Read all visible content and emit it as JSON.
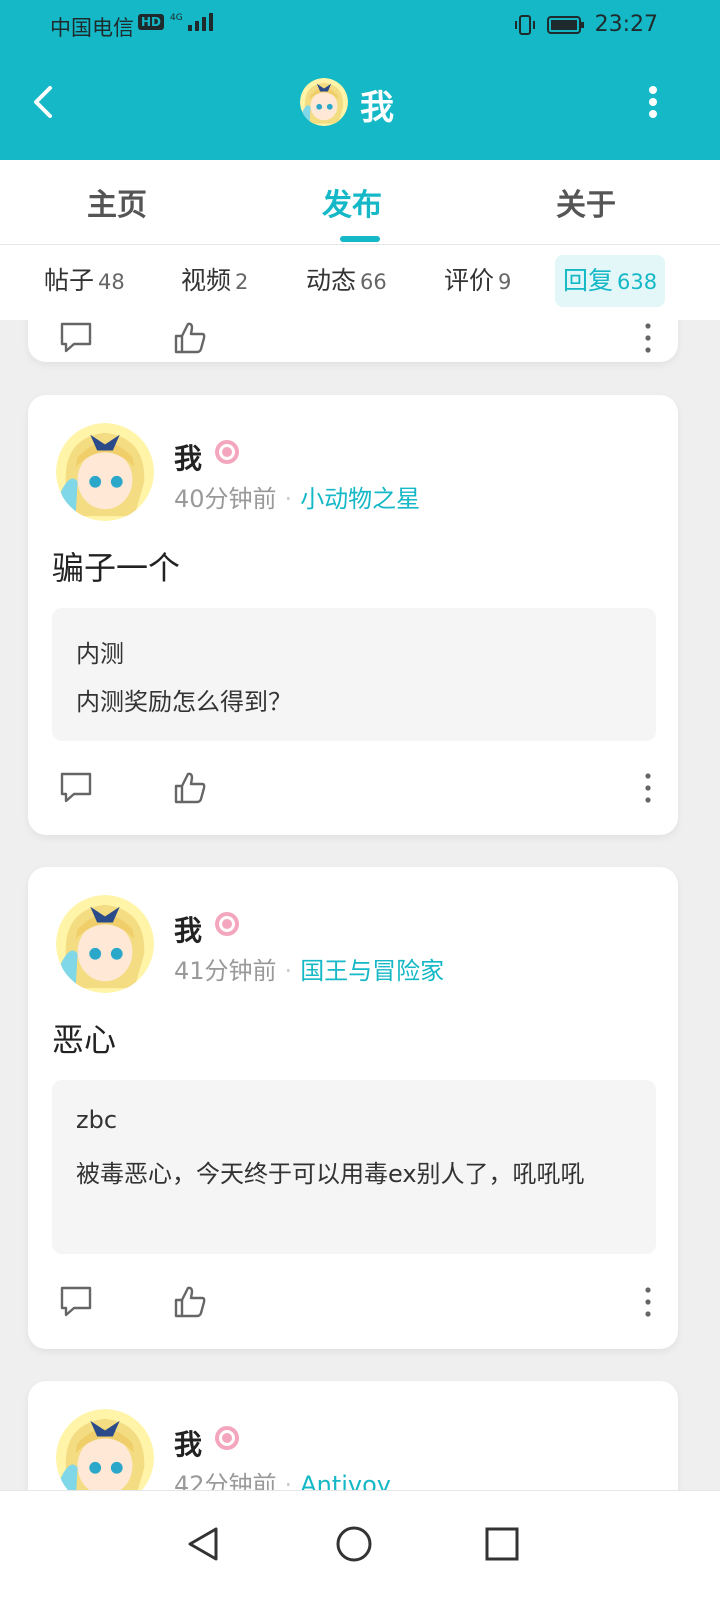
{
  "status_bar": {
    "carrier": "中国电信",
    "hd": "HD",
    "network": "4G",
    "time": "23:27"
  },
  "header": {
    "title": "我",
    "back_icon": "chevron-left-icon",
    "more_icon": "vertical-dots-icon"
  },
  "main_tabs": [
    {
      "label": "主页",
      "active": false
    },
    {
      "label": "发布",
      "active": true
    },
    {
      "label": "关于",
      "active": false
    }
  ],
  "sub_tabs": [
    {
      "label": "帖子",
      "count": "48",
      "active": false
    },
    {
      "label": "视频",
      "count": "2",
      "active": false
    },
    {
      "label": "动态",
      "count": "66",
      "active": false
    },
    {
      "label": "评价",
      "count": "9",
      "active": false
    },
    {
      "label": "回复",
      "count": "638",
      "active": true
    }
  ],
  "posts": [
    {
      "username": "我",
      "time": "40分钟前",
      "game": "小动物之星",
      "text": "骗子一个",
      "quote_title": "内测",
      "quote_text": "内测奖励怎么得到？"
    },
    {
      "username": "我",
      "time": "41分钟前",
      "game": "国王与冒险家",
      "text": "恶心",
      "quote_title": "zbc",
      "quote_text": "被毒恶心，今天终于可以用毒ex别人了，吼吼吼"
    },
    {
      "username": "我",
      "time": "42分钟前",
      "game": "Antivoy"
    }
  ],
  "colors": {
    "accent": "#14b8c6",
    "background": "#efefef",
    "level_badge": "#f3a6bd"
  },
  "icons": {
    "comment": "comment-icon",
    "like": "thumbs-up-icon",
    "more": "vertical-dots-icon",
    "level": "level-badge-icon"
  },
  "system_nav": [
    "back-triangle-icon",
    "home-circle-icon",
    "recents-square-icon"
  ]
}
